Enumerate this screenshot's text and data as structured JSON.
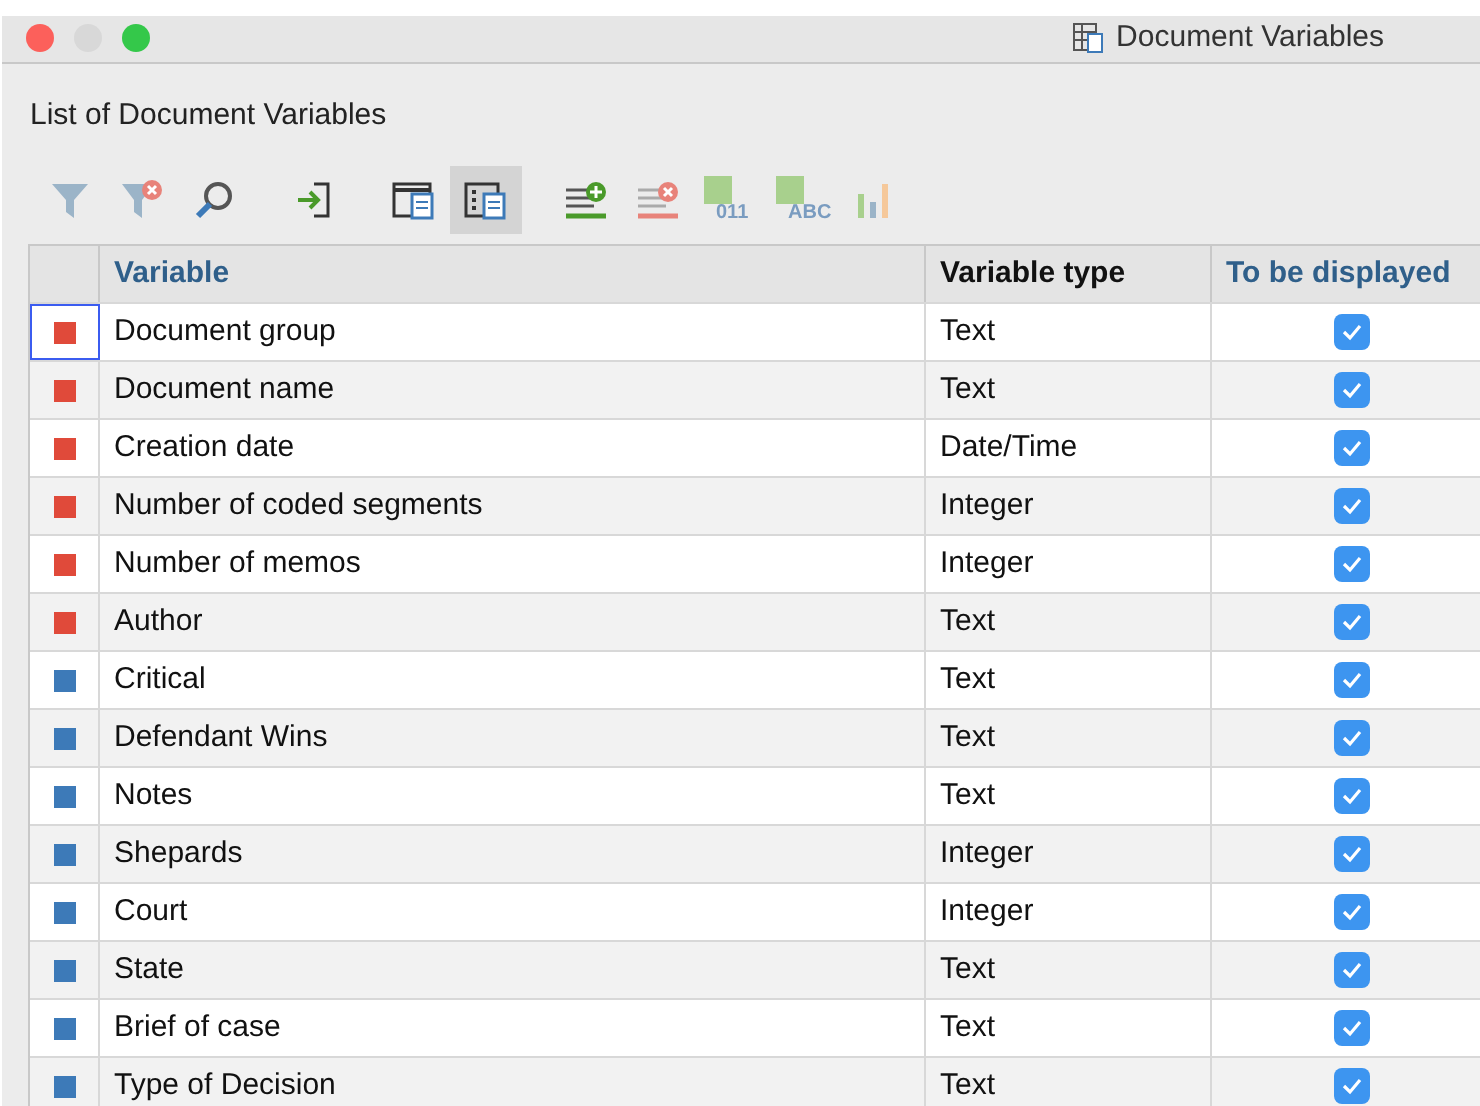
{
  "window": {
    "title": "Document Variables"
  },
  "heading": "List of Document Variables",
  "toolbar": [
    {
      "kind": "filter",
      "selected": false
    },
    {
      "kind": "filter-clear",
      "selected": false
    },
    {
      "kind": "search",
      "selected": false
    },
    {
      "kind": "import",
      "selected": false
    },
    {
      "kind": "view-a",
      "selected": false
    },
    {
      "kind": "view-b",
      "selected": true
    },
    {
      "kind": "add",
      "selected": false
    },
    {
      "kind": "remove",
      "selected": false
    },
    {
      "kind": "tag",
      "label": "011",
      "selected": false
    },
    {
      "kind": "tag",
      "label": "ABC",
      "selected": false
    },
    {
      "kind": "chart",
      "selected": false
    }
  ],
  "table": {
    "columns": [
      {
        "label": "Variable",
        "highlighted": true
      },
      {
        "label": "Variable type",
        "highlighted": false
      },
      {
        "label": "To be displayed",
        "highlighted": true
      }
    ],
    "rows": [
      {
        "color": "#e04a3a",
        "name": "Document group",
        "type": "Text",
        "checked": true,
        "selected": true
      },
      {
        "color": "#e04a3a",
        "name": "Document name",
        "type": "Text",
        "checked": true,
        "selected": false
      },
      {
        "color": "#e04a3a",
        "name": "Creation date",
        "type": "Date/Time",
        "checked": true,
        "selected": false
      },
      {
        "color": "#e04a3a",
        "name": "Number of coded segments",
        "type": "Integer",
        "checked": true,
        "selected": false
      },
      {
        "color": "#e04a3a",
        "name": "Number of memos",
        "type": "Integer",
        "checked": true,
        "selected": false
      },
      {
        "color": "#e04a3a",
        "name": "Author",
        "type": "Text",
        "checked": true,
        "selected": false
      },
      {
        "color": "#3d7ab8",
        "name": "Critical",
        "type": "Text",
        "checked": true,
        "selected": false
      },
      {
        "color": "#3d7ab8",
        "name": "Defendant Wins",
        "type": "Text",
        "checked": true,
        "selected": false
      },
      {
        "color": "#3d7ab8",
        "name": "Notes",
        "type": "Text",
        "checked": true,
        "selected": false
      },
      {
        "color": "#3d7ab8",
        "name": "Shepards",
        "type": "Integer",
        "checked": true,
        "selected": false
      },
      {
        "color": "#3d7ab8",
        "name": "Court",
        "type": "Integer",
        "checked": true,
        "selected": false
      },
      {
        "color": "#3d7ab8",
        "name": "State",
        "type": "Text",
        "checked": true,
        "selected": false
      },
      {
        "color": "#3d7ab8",
        "name": "Brief of case",
        "type": "Text",
        "checked": true,
        "selected": false
      },
      {
        "color": "#3d7ab8",
        "name": "Type of Decision",
        "type": "Text",
        "checked": true,
        "selected": false
      }
    ]
  }
}
